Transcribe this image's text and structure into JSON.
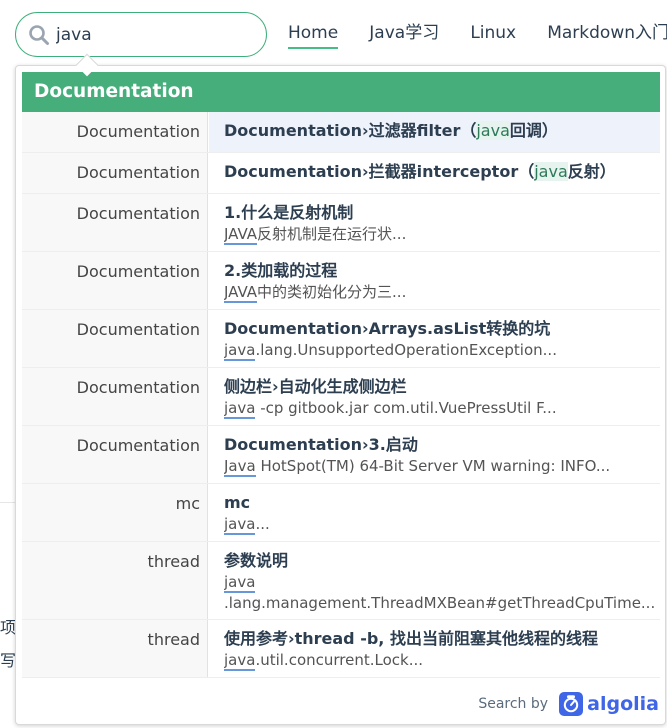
{
  "search": {
    "value": "java",
    "placeholder": ""
  },
  "nav": {
    "links": [
      {
        "label": "Home"
      },
      {
        "label": "Java学习"
      },
      {
        "label": "Linux"
      },
      {
        "label": "Markdown入门"
      }
    ]
  },
  "dropdown": {
    "header": "Documentation",
    "results": [
      {
        "category": "Documentation",
        "title_pre": "Documentation›过滤器filter（",
        "title_mark": "java",
        "title_post": "回调）",
        "snippet_mark": "",
        "snippet_rest": ""
      },
      {
        "category": "Documentation",
        "title_pre": "Documentation›拦截器interceptor（",
        "title_mark": "java",
        "title_post": "反射）",
        "snippet_mark": "",
        "snippet_rest": ""
      },
      {
        "category": "Documentation",
        "title_pre": "1.什么是反射机制",
        "title_mark": "",
        "title_post": "",
        "snippet_mark": "JAVA",
        "snippet_rest": "反射机制是在运行状..."
      },
      {
        "category": "Documentation",
        "title_pre": "2.类加载的过程",
        "title_mark": "",
        "title_post": "",
        "snippet_mark": "JAVA",
        "snippet_rest": "中的类初始化分为三..."
      },
      {
        "category": "Documentation",
        "title_pre": "Documentation›Arrays.asList转换的坑",
        "title_mark": "",
        "title_post": "",
        "snippet_mark": "java",
        "snippet_rest": ".lang.UnsupportedOperationException..."
      },
      {
        "category": "Documentation",
        "title_pre": "侧边栏›自动化生成侧边栏",
        "title_mark": "",
        "title_post": "",
        "snippet_mark": "java",
        "snippet_rest": " -cp gitbook.jar com.util.VuePressUtil F..."
      },
      {
        "category": "Documentation",
        "title_pre": "Documentation›3.启动",
        "title_mark": "",
        "title_post": "",
        "snippet_mark": "Java",
        "snippet_rest": " HotSpot(TM) 64-Bit Server VM warning: INFO..."
      },
      {
        "category": "mc",
        "title_pre": "mc",
        "title_mark": "",
        "title_post": "",
        "snippet_mark": "java",
        "snippet_rest": "..."
      },
      {
        "category": "thread",
        "title_pre": "参数说明",
        "title_mark": "",
        "title_post": "",
        "snippet_mark": "java",
        "snippet_rest": "",
        "snippet_line2": ".lang.management.ThreadMXBean#getThreadCpuTime..."
      },
      {
        "category": "thread",
        "title_pre": "使用参考›thread -b, 找出当前阻塞其他线程的线程",
        "title_mark": "",
        "title_post": "",
        "snippet_mark": "java",
        "snippet_rest": ".util.concurrent.Lock..."
      }
    ],
    "footer": {
      "search_by": "Search by",
      "brand": "algolia"
    }
  },
  "background_page": {
    "line1": "项",
    "line2": "写"
  },
  "colors": {
    "accent": "#3eaf7c",
    "header_bg": "#45ae7b",
    "highlight_row": "#eef2fb",
    "algolia_blue": "#3e66e6"
  }
}
